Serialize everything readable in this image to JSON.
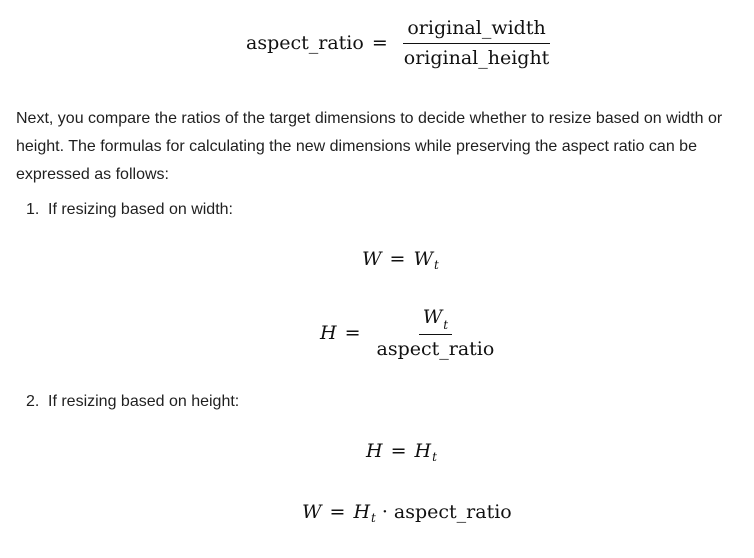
{
  "formula_aspect": {
    "lhs": "aspect_ratio",
    "eq": "=",
    "numerator": "original_width",
    "denominator": "original_height"
  },
  "paragraph": "Next, you compare the ratios of the target dimensions to decide whether to resize based on width or height. The formulas for calculating the new dimensions while preserving the aspect ratio can be expressed as follows:",
  "list": [
    {
      "marker": "1.",
      "text": "If resizing based on width:",
      "eq1": {
        "lhs": "W",
        "eq": "=",
        "rhs": "W",
        "rhs_sub": "t"
      },
      "eq2": {
        "lhs": "H",
        "eq": "=",
        "num": "W",
        "num_sub": "t",
        "den": "aspect_ratio"
      }
    },
    {
      "marker": "2.",
      "text": "If resizing based on height:",
      "eq1": {
        "lhs": "H",
        "eq": "=",
        "rhs": "H",
        "rhs_sub": "t"
      },
      "eq2": {
        "lhs": "W",
        "eq": "=",
        "rhs": "H",
        "rhs_sub": "t",
        "dot": "·",
        "tail": "aspect_ratio"
      }
    }
  ]
}
